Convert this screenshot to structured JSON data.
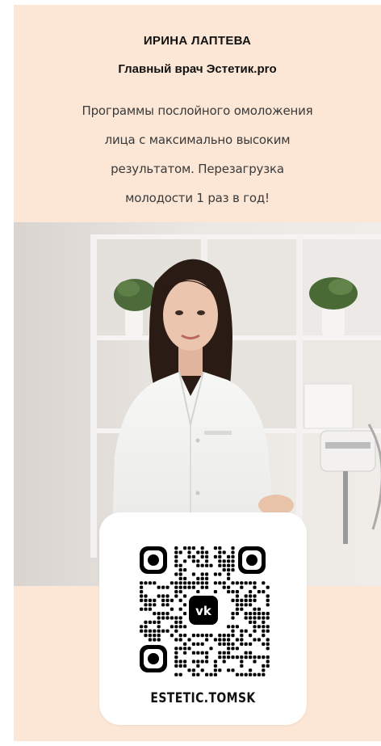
{
  "profile": {
    "name": "ИРИНА ЛАПТЕВА",
    "role": "Главный врач Эстетик.pro",
    "description_lines": [
      "Программы послойного омоложения",
      "лица с максимально высоким",
      "результатом. Перезагрузка",
      "молодости 1 раз в год!"
    ]
  },
  "qr": {
    "handle": "ESTETIC.TOMSK",
    "center_icon": "vk-logo-icon"
  },
  "colors": {
    "card_background": "#fce7d6",
    "text": "#111111",
    "qr_dark": "#000000"
  }
}
